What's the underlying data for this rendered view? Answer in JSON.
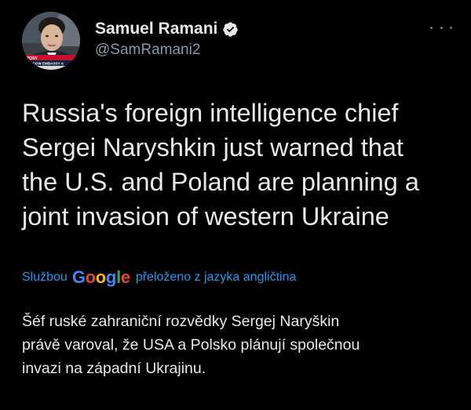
{
  "author": {
    "name": "Samuel Ramani",
    "handle": "@SamRamani2",
    "avatar_caption_top": "STORY",
    "avatar_caption_bottom": "MOSCOW EMBASSY A"
  },
  "icons": {
    "verified": "verified-badge-icon",
    "more": "more-options-icon"
  },
  "tweet": {
    "text": "Russia's foreign intelligence chief\nSergei Naryshkin just warned that\nthe U.S. and Poland are planning a\njoint invasion of western Ukraine"
  },
  "translation": {
    "prefix": "Službou",
    "provider": "Google",
    "suffix": "přeloženo z jazyka angličtina",
    "text": "Šéf ruské zahraniční rozvědky Sergej Naryškin\nprávě varoval, že USA a Polsko plánují společnou\ninvazi na západní Ukrajinu."
  },
  "colors": {
    "background": "#000000",
    "primary_text": "#e7e9ea",
    "secondary_text": "#8b98a5",
    "link": "#1d9bf0",
    "verified_badge": "#e7e9ea",
    "google_blue": "#4285f4",
    "google_red": "#ea4335",
    "google_yellow": "#fbbc05",
    "google_green": "#34a853"
  }
}
